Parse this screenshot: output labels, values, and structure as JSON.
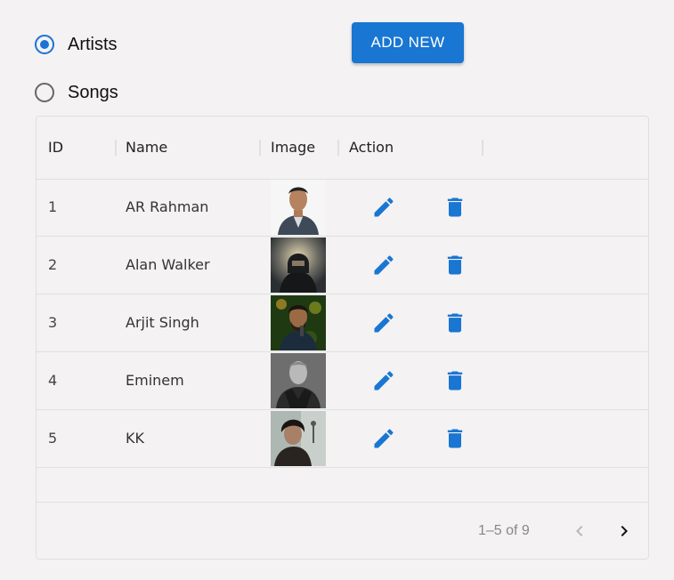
{
  "filter": {
    "options": [
      {
        "label": "Artists",
        "checked": true
      },
      {
        "label": "Songs",
        "checked": false
      }
    ]
  },
  "toolbar": {
    "add_label": "ADD NEW"
  },
  "table": {
    "columns": [
      "ID",
      "Name",
      "Image",
      "Action"
    ],
    "rows": [
      {
        "id": "1",
        "name": "AR Rahman",
        "image": "ar-rahman-photo"
      },
      {
        "id": "2",
        "name": "Alan Walker",
        "image": "alan-walker-photo"
      },
      {
        "id": "3",
        "name": "Arjit Singh",
        "image": "arjit-singh-photo"
      },
      {
        "id": "4",
        "name": "Eminem",
        "image": "eminem-photo"
      },
      {
        "id": "5",
        "name": "KK",
        "image": "kk-photo"
      }
    ]
  },
  "pagination": {
    "range_text": "1–5 of 9"
  },
  "colors": {
    "accent": "#1976d2",
    "background": "#f4f2f3",
    "border": "#e0e0e0"
  },
  "icons": {
    "edit": "pencil-icon",
    "delete": "trash-icon",
    "prev": "chevron-left-icon",
    "next": "chevron-right-icon"
  }
}
